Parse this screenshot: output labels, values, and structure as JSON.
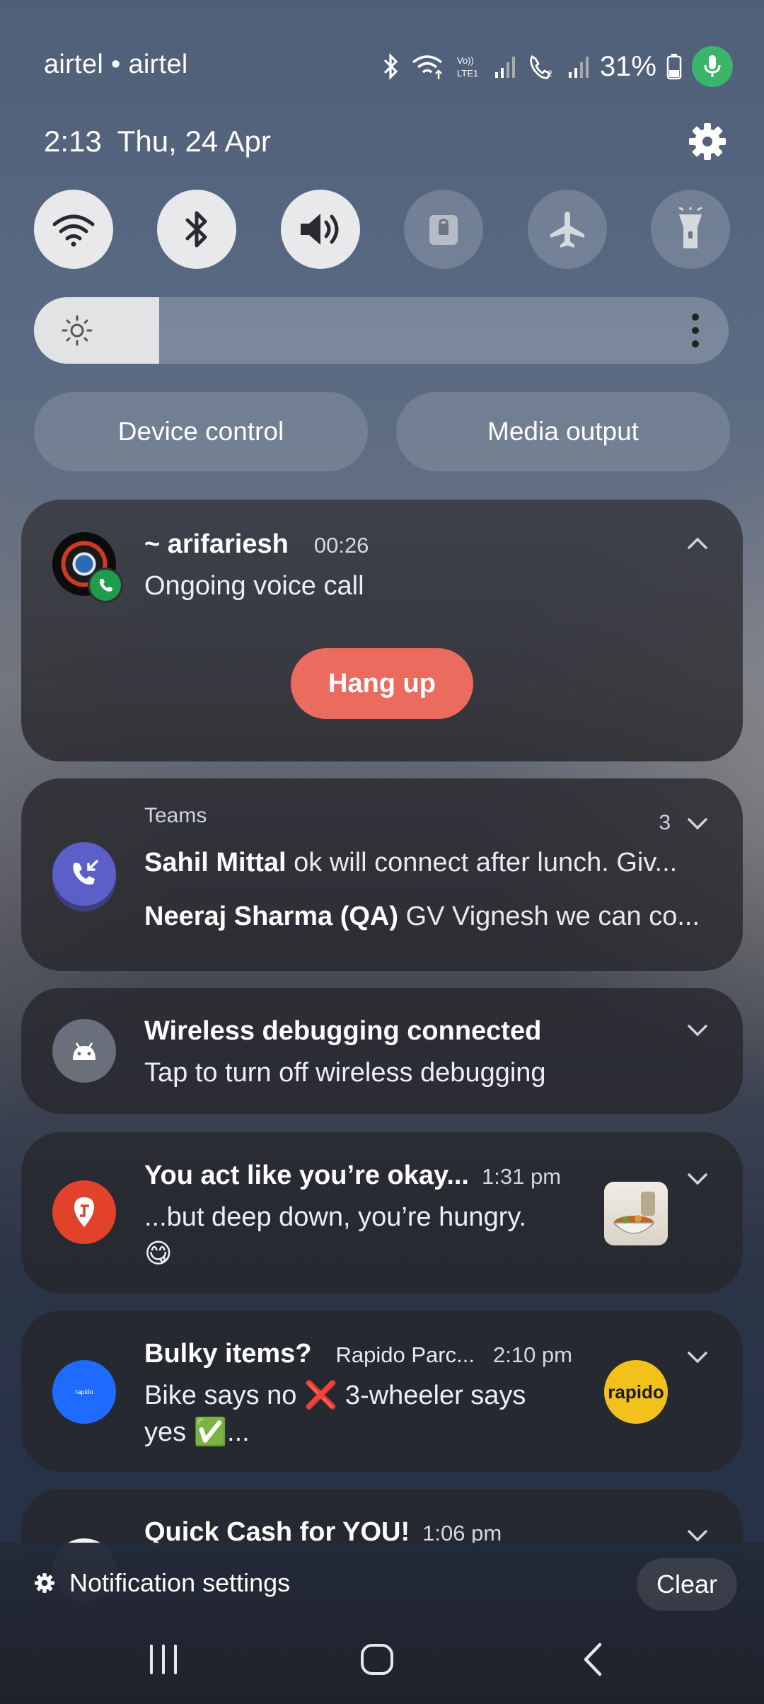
{
  "status_bar": {
    "carrier": "airtel • airtel",
    "battery": "31%",
    "time": "2:13",
    "date": "Thu, 24 Apr"
  },
  "icons": {
    "wifi": "wifi-icon",
    "bluetooth": "bluetooth-icon",
    "sound": "volume-icon",
    "rotation_lock": "lock-icon",
    "airplane": "airplane-icon",
    "flashlight": "flashlight-icon",
    "settings": "gear-icon"
  },
  "quick_toggles": [
    {
      "id": "wifi",
      "state": "on"
    },
    {
      "id": "bluetooth",
      "state": "on"
    },
    {
      "id": "sound",
      "state": "on"
    },
    {
      "id": "rotation_lock",
      "state": "off"
    },
    {
      "id": "airplane",
      "state": "off"
    },
    {
      "id": "flashlight",
      "state": "off"
    }
  ],
  "brightness": {
    "level_percent": 18
  },
  "pills": {
    "device_control": "Device control",
    "media_output": "Media output"
  },
  "notifications": {
    "call": {
      "caller": "~ arifariesh",
      "duration": "00:26",
      "status": "Ongoing voice call",
      "action": "Hang up"
    },
    "teams": {
      "app": "Teams",
      "count": "3",
      "messages": [
        {
          "sender": "Sahil Mittal",
          "text": "ok will connect after lunch. Giv..."
        },
        {
          "sender": "Neeraj Sharma (QA)",
          "text": "GV Vignesh we can co..."
        }
      ]
    },
    "debug": {
      "title": "Wireless debugging connected",
      "body": "Tap to turn off wireless debugging"
    },
    "swiggy": {
      "title": "You act like you’re okay...",
      "time": "1:31 pm",
      "body_line1": "...but deep down, you’re hungry.",
      "body_line2": "😋"
    },
    "rapido": {
      "title": "Bulky items?",
      "app": "Rapido Parc...",
      "time": "2:10 pm",
      "body_line1": "Bike says no ❌ 3-wheeler says",
      "body_line2": "yes ✅...",
      "icon_label": "rapido",
      "thumb_label": "rapido"
    },
    "cash": {
      "title": "Quick Cash for YOU!",
      "time": "1:06 pm"
    }
  },
  "footer": {
    "notification_settings": "Notification settings",
    "clear": "Clear"
  },
  "colors": {
    "hangup": "#ec6b5f",
    "teams": "#5b5fc7",
    "swiggy": "#e2412a",
    "rapido_blue": "#1f6bff",
    "rapido_yellow": "#f2c11b",
    "mic_green": "#3bb56a"
  }
}
